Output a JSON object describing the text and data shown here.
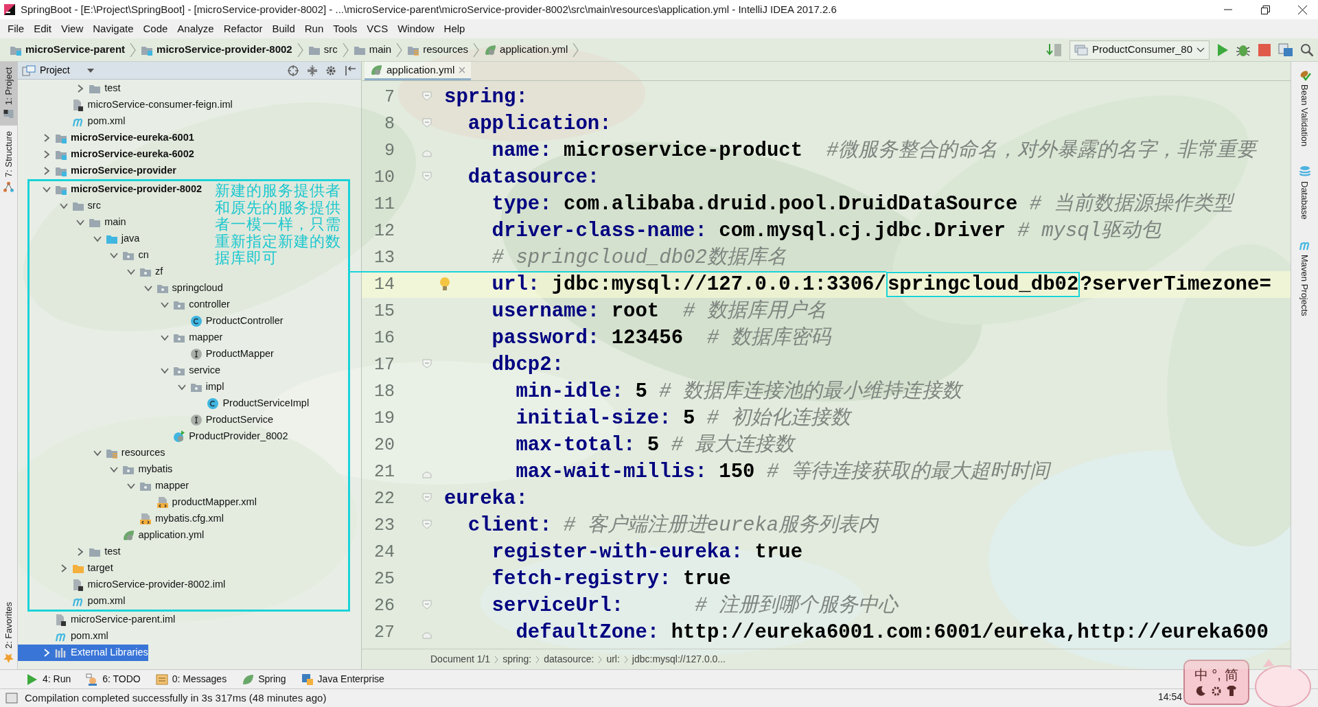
{
  "window": {
    "title": "SpringBoot - [E:\\Project\\SpringBoot] - [microService-provider-8002] - ...\\microService-parent\\microService-provider-8002\\src\\main\\resources\\application.yml - IntelliJ IDEA 2017.2.6"
  },
  "menu": [
    "File",
    "Edit",
    "View",
    "Navigate",
    "Code",
    "Analyze",
    "Refactor",
    "Build",
    "Run",
    "Tools",
    "VCS",
    "Window",
    "Help"
  ],
  "breadcrumbs": [
    {
      "label": "microService-parent",
      "kind": "module"
    },
    {
      "label": "microService-provider-8002",
      "kind": "module"
    },
    {
      "label": "src",
      "kind": "folder"
    },
    {
      "label": "main",
      "kind": "folder"
    },
    {
      "label": "resources",
      "kind": "resources-folder"
    },
    {
      "label": "application.yml",
      "kind": "yml"
    }
  ],
  "run_config": "ProductConsumer_80",
  "left_tool_tabs": [
    {
      "label": "1: Project",
      "selected": true,
      "kind": "project"
    },
    {
      "label": "7: Structure",
      "selected": false,
      "kind": "structure"
    },
    {
      "label": "2: Favorites",
      "selected": false,
      "kind": "favorites"
    }
  ],
  "right_tool_tabs": [
    {
      "label": "Bean Validation",
      "kind": "bean"
    },
    {
      "label": "Database",
      "kind": "database"
    },
    {
      "label": "Maven Projects",
      "kind": "maven"
    }
  ],
  "project": {
    "title": "Project",
    "tree": [
      {
        "children": [
          {
            "children": [
              {
                "children": [
                  {
                    "label": "test",
                    "kind": "folder",
                    "expanded": false,
                    "selected": false
                  }
                ]
              },
              {
                "label": "microService-consumer-feign.iml",
                "kind": "iml",
                "selected": false
              },
              {
                "label": "pom.xml",
                "kind": "pom",
                "selected": false
              }
            ]
          },
          {
            "label": "microService-eureka-6001",
            "kind": "module",
            "expanded": false,
            "selected": false
          },
          {
            "label": "microService-eureka-6002",
            "kind": "module",
            "expanded": false,
            "selected": false
          },
          {
            "label": "microService-provider",
            "kind": "module",
            "expanded": false,
            "selected": false
          },
          {
            "label": "microService-provider-8002",
            "kind": "module",
            "expanded": true,
            "selected": false,
            "note": "新建的服务提供者和原先的服务提供者一模一样，只需重新指定新建的数据库即可",
            "children": [
              {
                "label": "src",
                "kind": "folder",
                "expanded": true,
                "selected": false,
                "children": [
                  {
                    "label": "main",
                    "kind": "folder",
                    "expanded": true,
                    "selected": false,
                    "children": [
                      {
                        "label": "java",
                        "kind": "java-folder",
                        "expanded": true,
                        "selected": false,
                        "children": [
                          {
                            "label": "cn",
                            "kind": "package",
                            "expanded": true,
                            "selected": false,
                            "children": [
                              {
                                "label": "zf",
                                "kind": "package",
                                "expanded": true,
                                "selected": false,
                                "children": [
                                  {
                                    "label": "springcloud",
                                    "kind": "package",
                                    "expanded": true,
                                    "selected": false,
                                    "children": [
                                      {
                                        "label": "controller",
                                        "kind": "package",
                                        "expanded": true,
                                        "selected": false,
                                        "children": [
                                          {
                                            "label": "ProductController",
                                            "kind": "class",
                                            "selected": false
                                          }
                                        ]
                                      },
                                      {
                                        "label": "mapper",
                                        "kind": "package",
                                        "expanded": true,
                                        "selected": false,
                                        "children": [
                                          {
                                            "label": "ProductMapper",
                                            "kind": "interface",
                                            "selected": false
                                          }
                                        ]
                                      },
                                      {
                                        "label": "service",
                                        "kind": "package",
                                        "expanded": true,
                                        "selected": false,
                                        "children": [
                                          {
                                            "label": "impl",
                                            "kind": "package",
                                            "expanded": true,
                                            "selected": false,
                                            "children": [
                                              {
                                                "label": "ProductServiceImpl",
                                                "kind": "class",
                                                "selected": false
                                              }
                                            ]
                                          },
                                          {
                                            "label": "ProductService",
                                            "kind": "interface",
                                            "selected": false
                                          }
                                        ]
                                      },
                                      {
                                        "label": "ProductProvider_8002",
                                        "kind": "spring-app",
                                        "selected": false
                                      }
                                    ]
                                  }
                                ]
                              }
                            ]
                          }
                        ]
                      },
                      {
                        "label": "resources",
                        "kind": "resources-folder",
                        "expanded": true,
                        "selected": false,
                        "children": [
                          {
                            "label": "mybatis",
                            "kind": "package",
                            "expanded": true,
                            "selected": false,
                            "children": [
                              {
                                "label": "mapper",
                                "kind": "package",
                                "expanded": true,
                                "selected": false,
                                "children": [
                                  {
                                    "label": "productMapper.xml",
                                    "kind": "xml",
                                    "selected": false
                                  }
                                ]
                              },
                              {
                                "label": "mybatis.cfg.xml",
                                "kind": "xml",
                                "selected": false
                              }
                            ]
                          },
                          {
                            "label": "application.yml",
                            "kind": "yml",
                            "selected": false
                          }
                        ]
                      }
                    ]
                  },
                  {
                    "label": "test",
                    "kind": "folder",
                    "expanded": false,
                    "selected": false
                  }
                ]
              },
              {
                "label": "target",
                "kind": "target-folder",
                "expanded": false,
                "selected": false
              },
              {
                "label": "microService-provider-8002.iml",
                "kind": "iml",
                "selected": false
              },
              {
                "label": "pom.xml",
                "kind": "pom",
                "selected": false
              }
            ]
          },
          {
            "label": "microService-parent.iml",
            "kind": "iml",
            "selected": false
          },
          {
            "label": "pom.xml",
            "kind": "pom",
            "selected": false
          }
        ]
      },
      {
        "label": "External Libraries",
        "kind": "libraries",
        "expanded": false,
        "selected": true
      }
    ]
  },
  "editor": {
    "tabs": [
      {
        "label": "application.yml",
        "selected": true
      }
    ],
    "lines": [
      {
        "number": "7",
        "fold_start": true,
        "fold_end": false,
        "current": false,
        "segments": [
          {
            "text": "spring:",
            "kind": "key"
          }
        ]
      },
      {
        "number": "8",
        "fold_start": true,
        "fold_end": false,
        "current": false,
        "segments": [
          {
            "text": "  application:",
            "kind": "key"
          }
        ]
      },
      {
        "number": "9",
        "fold_start": false,
        "fold_end": true,
        "current": false,
        "segments": [
          {
            "text": "    name:",
            "kind": "key"
          },
          {
            "text": " microservice-product",
            "kind": "value"
          },
          {
            "text": "  #微服务整合的命名，对外暴露的名字，非常重要",
            "kind": "comment"
          }
        ]
      },
      {
        "number": "10",
        "fold_start": true,
        "fold_end": false,
        "current": false,
        "segments": [
          {
            "text": "  datasource:",
            "kind": "key"
          }
        ]
      },
      {
        "number": "11",
        "current": false,
        "segments": [
          {
            "text": "    type:",
            "kind": "key"
          },
          {
            "text": " com.alibaba.druid.pool.DruidDataSource",
            "kind": "value"
          },
          {
            "text": " # 当前数据源操作类型",
            "kind": "comment"
          }
        ]
      },
      {
        "number": "12",
        "current": false,
        "segments": [
          {
            "text": "    driver-class-name:",
            "kind": "key"
          },
          {
            "text": " com.mysql.cj.jdbc.Driver",
            "kind": "value"
          },
          {
            "text": " # mysql驱动包",
            "kind": "comment"
          }
        ]
      },
      {
        "number": "13",
        "current": false,
        "segments": [
          {
            "text": "    # springcloud_db02数据库名",
            "kind": "comment"
          }
        ]
      },
      {
        "number": "14",
        "current": true,
        "segments": [
          {
            "text": "    url:",
            "kind": "key"
          },
          {
            "text": " jdbc:mysql://127.0.0.1:3306/",
            "kind": "value"
          },
          {
            "text": "springcloud_db02",
            "kind": "value",
            "boxed": true
          },
          {
            "text": "?serverTimezone=",
            "kind": "value"
          }
        ]
      },
      {
        "number": "15",
        "current": false,
        "segments": [
          {
            "text": "    username:",
            "kind": "key"
          },
          {
            "text": " root",
            "kind": "value"
          },
          {
            "text": "  # 数据库用户名",
            "kind": "comment"
          }
        ]
      },
      {
        "number": "16",
        "current": false,
        "segments": [
          {
            "text": "    password:",
            "kind": "key"
          },
          {
            "text": " 123456",
            "kind": "value"
          },
          {
            "text": "  # 数据库密码",
            "kind": "comment"
          }
        ]
      },
      {
        "number": "17",
        "fold_start": true,
        "fold_end": false,
        "current": false,
        "segments": [
          {
            "text": "    dbcp2:",
            "kind": "key"
          }
        ]
      },
      {
        "number": "18",
        "current": false,
        "segments": [
          {
            "text": "      min-idle:",
            "kind": "key"
          },
          {
            "text": " 5",
            "kind": "value"
          },
          {
            "text": " # 数据库连接池的最小维持连接数",
            "kind": "comment"
          }
        ]
      },
      {
        "number": "19",
        "current": false,
        "segments": [
          {
            "text": "      initial-size:",
            "kind": "key"
          },
          {
            "text": " 5",
            "kind": "value"
          },
          {
            "text": " # 初始化连接数",
            "kind": "comment"
          }
        ]
      },
      {
        "number": "20",
        "current": false,
        "segments": [
          {
            "text": "      max-total:",
            "kind": "key"
          },
          {
            "text": " 5",
            "kind": "value"
          },
          {
            "text": " # 最大连接数",
            "kind": "comment"
          }
        ]
      },
      {
        "number": "21",
        "fold_start": false,
        "fold_end": true,
        "current": false,
        "segments": [
          {
            "text": "      max-wait-millis:",
            "kind": "key"
          },
          {
            "text": " 150",
            "kind": "value"
          },
          {
            "text": " # 等待连接获取的最大超时时间",
            "kind": "comment"
          }
        ]
      },
      {
        "number": "22",
        "fold_start": true,
        "fold_end": false,
        "current": false,
        "segments": [
          {
            "text": "eureka:",
            "kind": "key"
          }
        ]
      },
      {
        "number": "23",
        "fold_start": true,
        "fold_end": false,
        "current": false,
        "segments": [
          {
            "text": "  client:",
            "kind": "key"
          },
          {
            "text": " # 客户端注册进eureka服务列表内",
            "kind": "comment"
          }
        ]
      },
      {
        "number": "24",
        "current": false,
        "segments": [
          {
            "text": "    register-with-eureka:",
            "kind": "key"
          },
          {
            "text": " true",
            "kind": "value"
          }
        ]
      },
      {
        "number": "25",
        "current": false,
        "segments": [
          {
            "text": "    fetch-registry:",
            "kind": "key"
          },
          {
            "text": " true",
            "kind": "value"
          }
        ]
      },
      {
        "number": "26",
        "fold_start": true,
        "fold_end": false,
        "current": false,
        "segments": [
          {
            "text": "    serviceUrl:",
            "kind": "key"
          },
          {
            "text": "      # 注册到哪个服务中心",
            "kind": "comment"
          }
        ]
      },
      {
        "number": "27",
        "fold_start": false,
        "fold_end": true,
        "current": false,
        "segments": [
          {
            "text": "      defaultZone:",
            "kind": "key"
          },
          {
            "text": " http://eureka6001.com:6001/eureka,http://eureka600",
            "kind": "value"
          }
        ]
      }
    ],
    "breadcrumbs": [
      "Document 1/1",
      "spring:",
      "datasource:",
      "url:",
      "jdbc:mysql://127.0.0..."
    ]
  },
  "tool_windows": [
    {
      "label": "4: Run",
      "kind": "run"
    },
    {
      "label": "6: TODO",
      "kind": "todo"
    },
    {
      "label": "0: Messages",
      "kind": "messages"
    },
    {
      "label": "Spring",
      "kind": "spring"
    },
    {
      "label": "Java Enterprise",
      "kind": "javaee"
    }
  ],
  "status_bar": {
    "message": "Compilation completed successfully in 3s 317ms (48 minutes ago)",
    "time": "14:54"
  },
  "ime": {
    "labels": [
      "中",
      "°,",
      "简"
    ]
  }
}
